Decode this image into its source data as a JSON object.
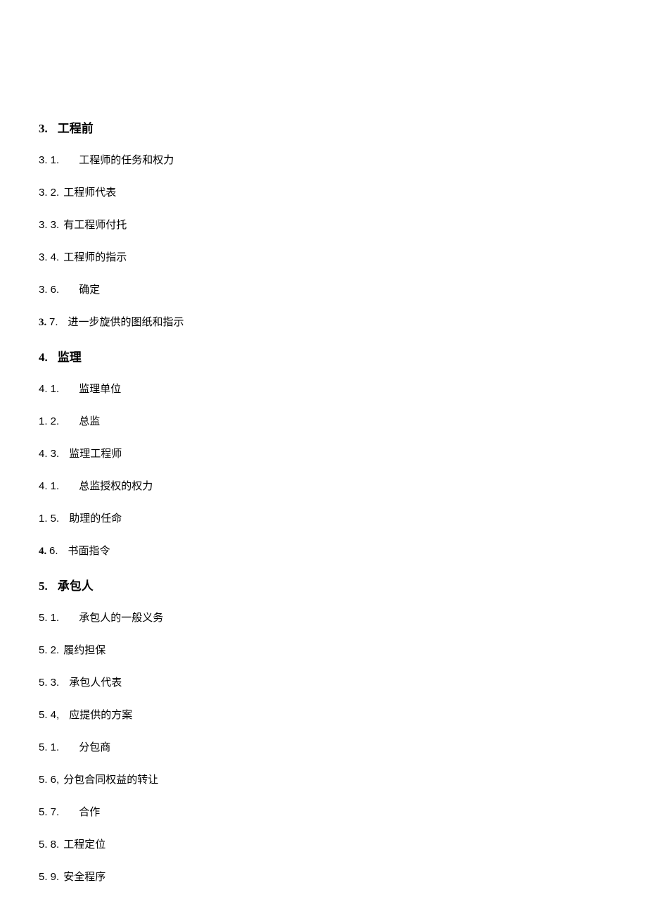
{
  "sections": [
    {
      "num": "3.",
      "title": "工程前",
      "items": [
        {
          "num": "3. 1.",
          "gap": "wide",
          "text": "工程师的任务和权力"
        },
        {
          "num": "3. 2.",
          "gap": "narrow",
          "text": "工程师代表"
        },
        {
          "num": "3. 3.",
          "gap": "narrow",
          "text": "有工程师付托"
        },
        {
          "num": "3.   4.",
          "gap": "narrow",
          "text": "工程师的指示"
        },
        {
          "num": "3. 6.",
          "gap": "wide",
          "text": "确定"
        },
        {
          "num": "3.",
          "gap": "med",
          "num2": "7.",
          "text": "进一步旋供的图纸和指示",
          "numBold": true
        }
      ]
    },
    {
      "num": "4.",
      "title": "监理",
      "items": [
        {
          "num": "4. 1.",
          "gap": "wide",
          "text": "监理单位"
        },
        {
          "num": "1. 2.",
          "gap": "wide",
          "text": "总监"
        },
        {
          "num": "4.   3.",
          "gap": "med",
          "text": "监理工程师"
        },
        {
          "num": "4. 1.",
          "gap": "wide",
          "text": "总监授权的权力"
        },
        {
          "num": "1.   5.",
          "gap": "med",
          "text": "助理的任命"
        },
        {
          "num": "4.",
          "gap": "med",
          "num2": "6.",
          "text": "书面指令",
          "numBold": true
        }
      ]
    },
    {
      "num": "5.",
      "title": "承包人",
      "items": [
        {
          "num": "5. 1.",
          "gap": "wide",
          "text": "承包人的一般义务"
        },
        {
          "num": "5. 2.",
          "gap": "narrow",
          "text": "履约担保"
        },
        {
          "num": "5.   3.",
          "gap": "med",
          "text": "承包人代表"
        },
        {
          "num": "5.   4,",
          "gap": "med",
          "text": "应提供的方案"
        },
        {
          "num": "5. 1.",
          "gap": "wide",
          "text": "分包商"
        },
        {
          "num": "5.   6,",
          "gap": "narrow",
          "text": "分包合同权益的转让"
        },
        {
          "num": "5. 7.",
          "gap": "wide",
          "text": "合作"
        },
        {
          "num": "5. 8.",
          "gap": "narrow",
          "text": "工程定位"
        },
        {
          "num": "5. 9.",
          "gap": "narrow",
          "text": "安全程序"
        }
      ]
    }
  ]
}
